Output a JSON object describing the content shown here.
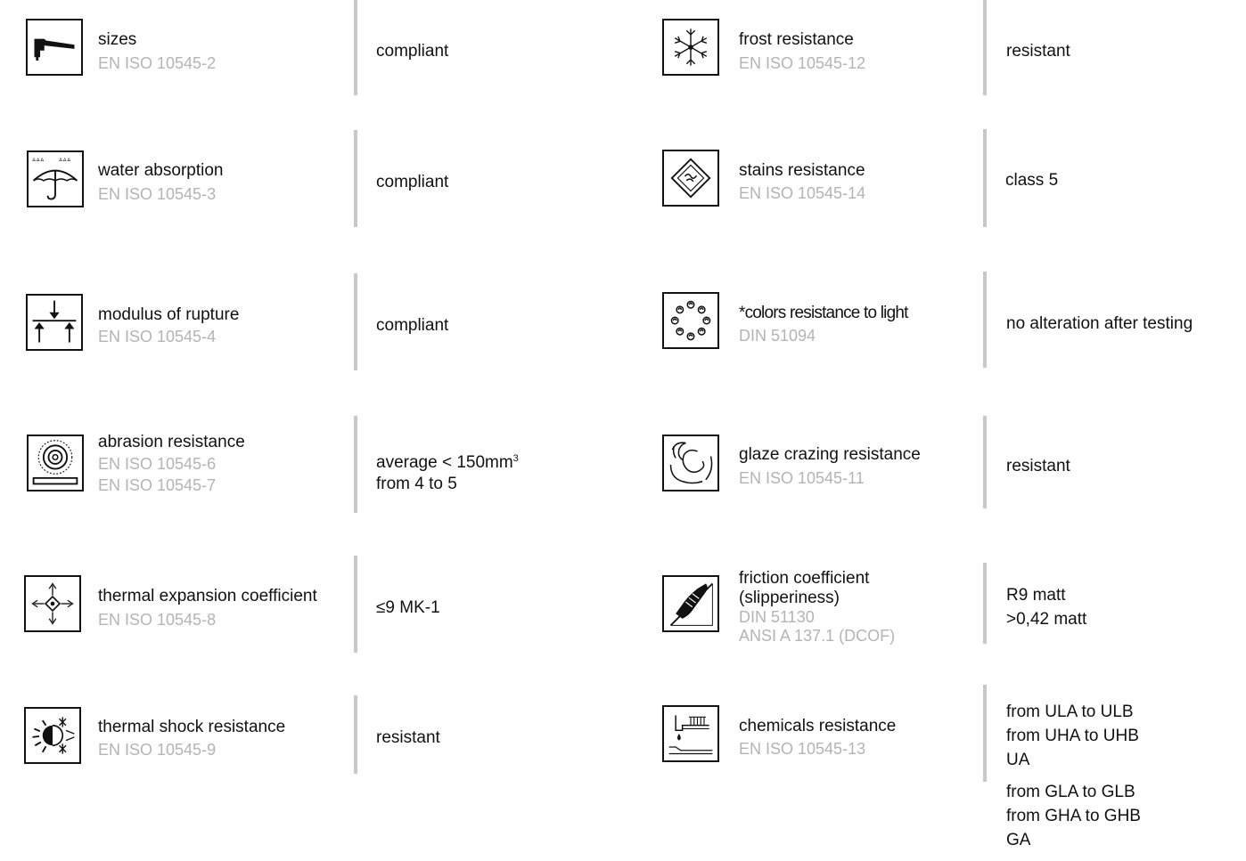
{
  "left": [
    {
      "name": "sizes",
      "standards": [
        "EN ISO 10545-2"
      ],
      "value": "compliant",
      "icon": "caliper-icon"
    },
    {
      "name": "water absorption",
      "standards": [
        "EN ISO 10545-3"
      ],
      "value": "compliant",
      "icon": "umbrella-rain-icon"
    },
    {
      "name": "modulus of rupture",
      "standards": [
        "EN ISO 10545-4"
      ],
      "value": "compliant",
      "icon": "load-arrows-icon"
    },
    {
      "name": "abrasion resistance",
      "standards": [
        "EN ISO 10545-6",
        "EN ISO 10545-7"
      ],
      "value_line1": "average < 150mm",
      "value_sup": "3",
      "value_line2": "from 4 to 5",
      "icon": "abrasion-disc-icon"
    },
    {
      "name": "thermal expansion coefficient",
      "standards": [
        "EN ISO 10545-8"
      ],
      "value": "≤9 MK-1",
      "icon": "expansion-arrows-icon"
    },
    {
      "name": "thermal shock resistance",
      "standards": [
        "EN ISO 10545-9"
      ],
      "value": "resistant",
      "icon": "sun-snowflake-icon"
    }
  ],
  "right": [
    {
      "name": "frost resistance",
      "standards": [
        "EN ISO 10545-12"
      ],
      "value": "resistant",
      "icon": "snowflake-icon"
    },
    {
      "name": "stains resistance",
      "standards": [
        "EN ISO 10545-14"
      ],
      "value": "class 5",
      "icon": "stain-diamond-icon"
    },
    {
      "name": "*colors resistance to light",
      "standards": [
        "DIN 51094"
      ],
      "value": "no alteration after testing",
      "icon": "light-swirl-icon"
    },
    {
      "name": "glaze crazing resistance",
      "standards": [
        "EN ISO 10545-11"
      ],
      "value": "resistant",
      "icon": "crazing-hands-icon"
    },
    {
      "name_line1": "friction coefficient",
      "name_line2": "(slipperiness)",
      "standards": [
        "DIN 51130",
        "ANSI A 137.1 (DCOF)"
      ],
      "values": [
        "R9 matt",
        ">0,42 matt"
      ],
      "icon": "shoe-slope-icon"
    },
    {
      "name": "chemicals resistance",
      "standards": [
        "EN ISO 10545-13"
      ],
      "values_group1": [
        "from ULA to ULB",
        "from UHA to UHB",
        "UA"
      ],
      "values_group2": [
        "from GLA to GLB",
        "from GHA to GHB",
        "GA"
      ],
      "icon": "chemical-drop-icon"
    }
  ],
  "colors": {
    "text": "#111111",
    "standard_text": "#b4b4b4",
    "divider": "#c8c8c8"
  }
}
